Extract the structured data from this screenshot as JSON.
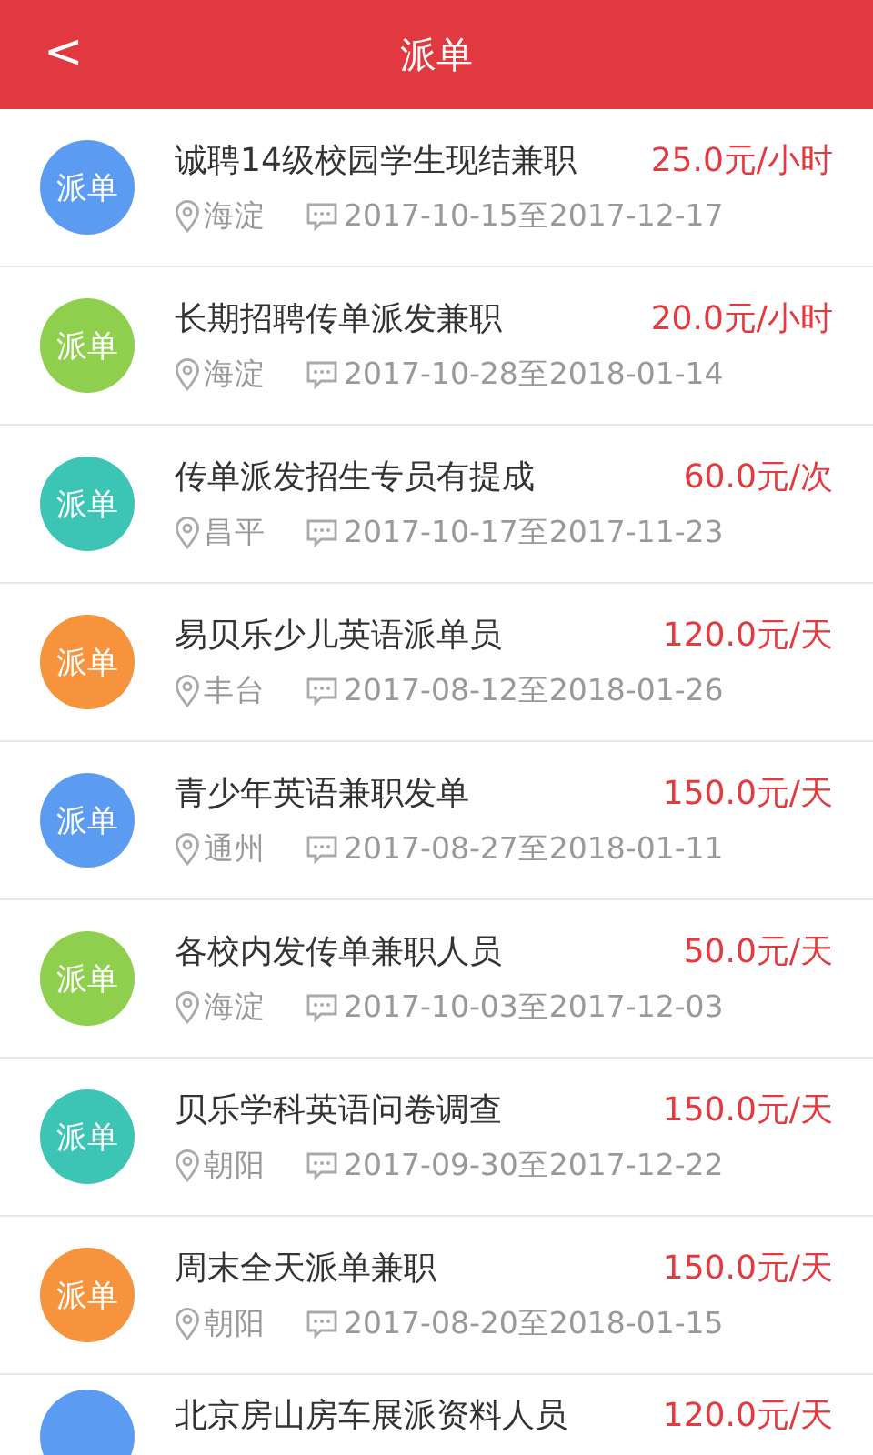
{
  "header": {
    "back": "<",
    "title": "派单"
  },
  "jobs": [
    {
      "badge": "派单",
      "color": "#5b9cf2",
      "title": "诚聘14级校园学生现结兼职",
      "price": "25.0元/小时",
      "district": "海淀",
      "dates": "2017-10-15至2017-12-17"
    },
    {
      "badge": "派单",
      "color": "#8ed04e",
      "title": "长期招聘传单派发兼职",
      "price": "20.0元/小时",
      "district": "海淀",
      "dates": "2017-10-28至2018-01-14"
    },
    {
      "badge": "派单",
      "color": "#3cc5b5",
      "title": "传单派发招生专员有提成",
      "price": "60.0元/次",
      "district": "昌平",
      "dates": "2017-10-17至2017-11-23"
    },
    {
      "badge": "派单",
      "color": "#f7923d",
      "title": "易贝乐少儿英语派单员",
      "price": "120.0元/天",
      "district": "丰台",
      "dates": "2017-08-12至2018-01-26"
    },
    {
      "badge": "派单",
      "color": "#5b9cf2",
      "title": "青少年英语兼职发单",
      "price": "150.0元/天",
      "district": "通州",
      "dates": "2017-08-27至2018-01-11"
    },
    {
      "badge": "派单",
      "color": "#8ed04e",
      "title": "各校内发传单兼职人员",
      "price": "50.0元/天",
      "district": "海淀",
      "dates": "2017-10-03至2017-12-03"
    },
    {
      "badge": "派单",
      "color": "#3cc5b5",
      "title": "贝乐学科英语问卷调查",
      "price": "150.0元/天",
      "district": "朝阳",
      "dates": "2017-09-30至2017-12-22"
    },
    {
      "badge": "派单",
      "color": "#f7923d",
      "title": "周末全天派单兼职",
      "price": "150.0元/天",
      "district": "朝阳",
      "dates": "2017-08-20至2018-01-15"
    },
    {
      "color": "#5b9cf2",
      "title": "北京房山房车展派资料人员",
      "price": "120.0元/天"
    }
  ]
}
